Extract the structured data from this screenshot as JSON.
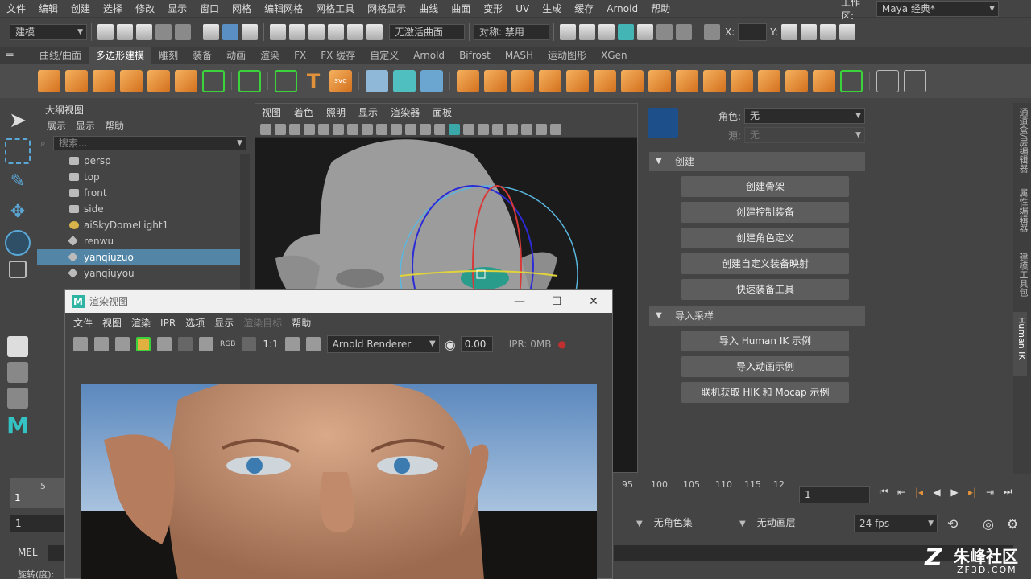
{
  "menubar": {
    "items": [
      "文件",
      "编辑",
      "创建",
      "选择",
      "修改",
      "显示",
      "窗口",
      "网格",
      "编辑网格",
      "网格工具",
      "网格显示",
      "曲线",
      "曲面",
      "变形",
      "UV",
      "生成",
      "缓存",
      "Arnold",
      "帮助"
    ],
    "workspace_label": "工作区:",
    "workspace_value": "Maya 经典*"
  },
  "statusline": {
    "mode": "建模",
    "live_surface": "无激活曲面",
    "symmetry": "对称: 禁用",
    "x_label": "X:",
    "y_label": "Y:"
  },
  "shelf": {
    "tabs": [
      "曲线/曲面",
      "多边形建模",
      "雕刻",
      "装备",
      "动画",
      "渲染",
      "FX",
      "FX 缓存",
      "自定义",
      "Arnold",
      "Bifrost",
      "MASH",
      "运动图形",
      "XGen"
    ],
    "active_tab": "多边形建模"
  },
  "outliner": {
    "title": "大纲视图",
    "menu": [
      "展示",
      "显示",
      "帮助"
    ],
    "search_placeholder": "搜索...",
    "items": [
      "persp",
      "top",
      "front",
      "side",
      "aiSkyDomeLight1",
      "renwu",
      "yanqiuzuo",
      "yanqiuyou"
    ],
    "selected": "yanqiuzuo"
  },
  "viewport": {
    "menu": [
      "视图",
      "着色",
      "照明",
      "显示",
      "渲染器",
      "面板"
    ]
  },
  "rightpanel": {
    "character_label": "角色:",
    "character_value": "无",
    "source_label": "源:",
    "source_value": "无",
    "create_section": "创建",
    "create_buttons": [
      "创建骨架",
      "创建控制装备",
      "创建角色定义",
      "创建自定义装备映射",
      "快速装备工具"
    ],
    "import_section": "导入采样",
    "import_buttons": [
      "导入 Human IK 示例",
      "导入动画示例",
      "联机获取 HIK 和 Mocap 示例"
    ],
    "side_tabs": [
      "通道盒/层编辑器",
      "属性编辑器",
      "建模工具包",
      "Human IK"
    ]
  },
  "render_view": {
    "title": "渲染视图",
    "menu": [
      "文件",
      "视图",
      "渲染",
      "IPR",
      "选项",
      "显示",
      "渲染目标",
      "帮助"
    ],
    "ratio": "1:1",
    "renderer": "Arnold Renderer",
    "exposure": "0.00",
    "ipr_mem": "IPR: 0MB",
    "rgb": "RGB"
  },
  "timeline": {
    "ticks_left": [
      "5"
    ],
    "ticks_right": [
      "95",
      "100",
      "105",
      "110",
      "115",
      "12"
    ],
    "current_frame": "1",
    "frame_left": "1",
    "range_start": "1",
    "char_set": "无角色集",
    "anim_layer": "无动画层",
    "fps": "24 fps"
  },
  "cmdline": {
    "label": "MEL",
    "help_text": "旋转(度):"
  },
  "watermark": {
    "name": "朱峰社区",
    "url": "ZF3D.COM"
  },
  "colors": {
    "accent": "#5285a6",
    "shelf_orange": "#e0913a",
    "highlight_green": "#3bd23b"
  }
}
